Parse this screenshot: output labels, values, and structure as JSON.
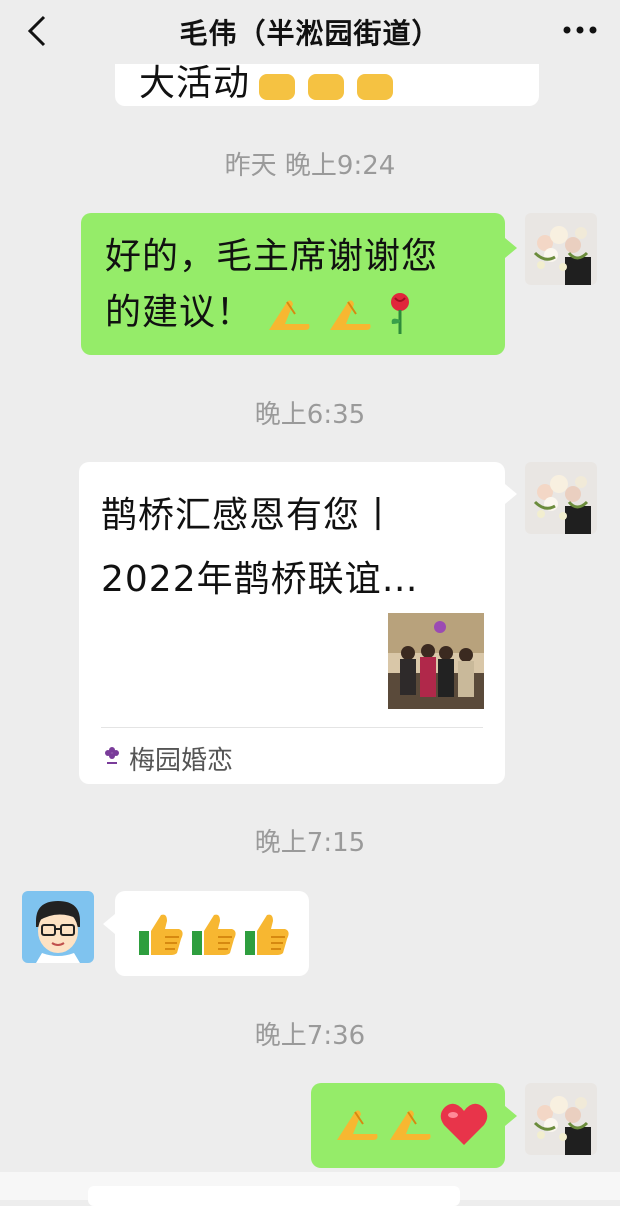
{
  "header": {
    "title": "毛伟（半淞园街道）",
    "back_icon": "chevron-left-icon",
    "more_icon": "more-dots-icon"
  },
  "messages": {
    "partial_top": {
      "text": "大活动"
    },
    "t1": "昨天 晚上9:24",
    "m1": {
      "line1": "好的，毛主席谢谢您",
      "line2": "的建议！"
    },
    "t2": "晚上6:35",
    "card": {
      "title_line1": "鹊桥汇感恩有您丨",
      "title_line2": "2022年鹊桥联谊…",
      "source": "梅园婚恋"
    },
    "t3": "晚上7:15",
    "t4": "晚上7:36"
  },
  "colors": {
    "background": "#ededed",
    "sent_bubble": "#95ec69",
    "received_bubble": "#ffffff",
    "timestamp": "#9a9a9a"
  }
}
